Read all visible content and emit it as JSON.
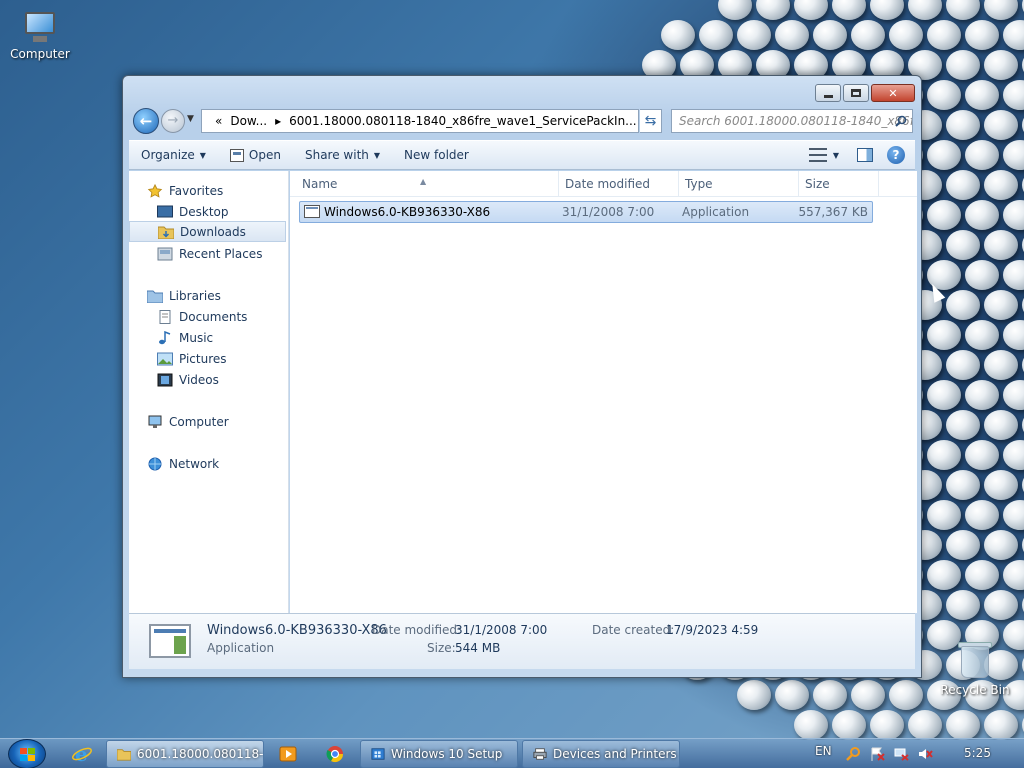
{
  "desktop": {
    "icons": [
      {
        "label": "Computer",
        "icon": "computer-icon"
      },
      {
        "label": "Recycle Bin",
        "icon": "recycle-bin-icon"
      }
    ]
  },
  "window": {
    "address": {
      "overflow": "«",
      "segments": [
        "Dow...",
        "6001.18000.080118-1840_x86fre_wave1_ServicePackIn..."
      ]
    },
    "search_placeholder": "Search 6001.18000.080118-1840_x86fre...",
    "toolbar": {
      "organize": "Organize",
      "open": "Open",
      "share_with": "Share with",
      "new_folder": "New folder"
    },
    "nav": {
      "favorites": "Favorites",
      "desktop": "Desktop",
      "downloads": "Downloads",
      "recent_places": "Recent Places",
      "libraries": "Libraries",
      "documents": "Documents",
      "music": "Music",
      "pictures": "Pictures",
      "videos": "Videos",
      "computer": "Computer",
      "network": "Network"
    },
    "columns": {
      "name": "Name",
      "date_modified": "Date modified",
      "type": "Type",
      "size": "Size"
    },
    "files": [
      {
        "name": "Windows6.0-KB936330-X86",
        "date_modified": "31/1/2008 7:00",
        "type": "Application",
        "size": "557,367 KB"
      }
    ],
    "details": {
      "name": "Windows6.0-KB936330-X86",
      "type": "Application",
      "date_modified_label": "Date modified:",
      "date_modified": "31/1/2008 7:00",
      "size_label": "Size:",
      "size": "544 MB",
      "date_created_label": "Date created:",
      "date_created": "17/9/2023 4:59"
    }
  },
  "taskbar": {
    "buttons": [
      {
        "label": "6001.18000.080118-1...",
        "active": true
      },
      {
        "label": "Windows 10 Setup",
        "active": false
      },
      {
        "label": "Devices and Printers",
        "active": false
      }
    ],
    "language": "EN",
    "clock": "5:25"
  },
  "colors": {
    "selection": "#c5daf3",
    "accent": "#1e395b",
    "close_button": "#c2442e"
  }
}
